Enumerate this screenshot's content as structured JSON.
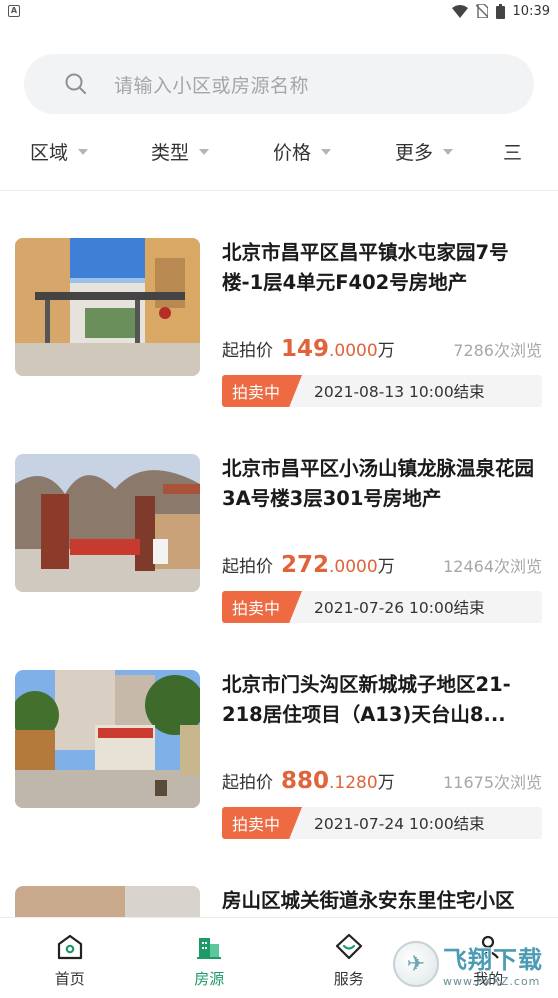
{
  "status_bar": {
    "notification": "A",
    "time": "10:39"
  },
  "search": {
    "placeholder": "请输入小区或房源名称"
  },
  "filters": [
    {
      "label": "区域"
    },
    {
      "label": "类型"
    },
    {
      "label": "价格"
    },
    {
      "label": "更多"
    },
    {
      "label": "三"
    }
  ],
  "listings": [
    {
      "title": "北京市昌平区昌平镇水屯家园7号楼-1层4单元F402号房地产",
      "price_label": "起拍价",
      "price_int": "149",
      "price_dec": ".0000",
      "price_unit": "万",
      "views": "7286次浏览",
      "status": "拍卖中",
      "end_time": "2021-08-13 10:00结束"
    },
    {
      "title": "北京市昌平区小汤山镇龙脉温泉花园3A号楼3层301号房地产",
      "price_label": "起拍价",
      "price_int": "272",
      "price_dec": ".0000",
      "price_unit": "万",
      "views": "12464次浏览",
      "status": "拍卖中",
      "end_time": "2021-07-26 10:00结束"
    },
    {
      "title": "北京市门头沟区新城城子地区21-218居住项目（A13)天台山8...",
      "price_label": "起拍价",
      "price_int": "880",
      "price_dec": ".1280",
      "price_unit": "万",
      "views": "11675次浏览",
      "status": "拍卖中",
      "end_time": "2021-07-24 10:00结束"
    },
    {
      "title": "房山区城关街道永安东里住宅小区"
    }
  ],
  "bottom_nav": [
    {
      "label": "首页",
      "icon": "home-icon",
      "active": false
    },
    {
      "label": "房源",
      "icon": "buildings-icon",
      "active": true
    },
    {
      "label": "服务",
      "icon": "service-icon",
      "active": false
    },
    {
      "label": "我的",
      "icon": "profile-icon",
      "active": false
    }
  ],
  "watermark": {
    "main": "飞翔下载",
    "url": "www.FXXZ.com"
  },
  "colors": {
    "accent": "#e0633a",
    "badge": "#ee6a42",
    "nav_active": "#1c9a68"
  }
}
